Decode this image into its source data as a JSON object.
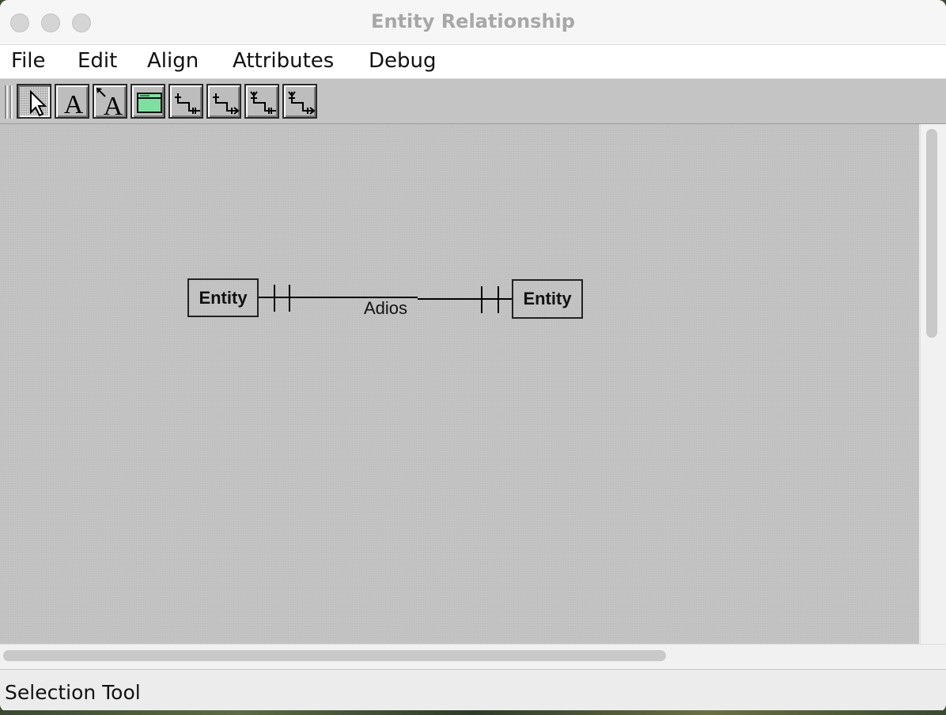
{
  "window": {
    "title": "Entity Relationship",
    "controls": [
      "close-button",
      "minimize-button",
      "zoom-button"
    ]
  },
  "menubar": {
    "items": [
      "File",
      "Edit",
      "Align",
      "Attributes",
      "Debug"
    ]
  },
  "toolbar": {
    "tools": [
      {
        "name": "selection-tool",
        "icon": "arrow-pointer-icon",
        "selected": true
      },
      {
        "name": "text-tool",
        "icon": "letter-a-icon",
        "selected": false
      },
      {
        "name": "connected-text-tool",
        "icon": "letter-a-with-arrow-icon",
        "selected": false
      },
      {
        "name": "entity-tool",
        "icon": "green-box-icon",
        "selected": false
      },
      {
        "name": "relationship-tool-1",
        "icon": "relation-one-one-icon",
        "selected": false
      },
      {
        "name": "relationship-tool-2",
        "icon": "relation-one-many-icon",
        "selected": false
      },
      {
        "name": "relationship-tool-3",
        "icon": "relation-many-one-icon",
        "selected": false
      },
      {
        "name": "relationship-tool-4",
        "icon": "relation-many-many-icon",
        "selected": false
      }
    ],
    "entity_icon_color": "#7ee0a0"
  },
  "diagram": {
    "entities": [
      {
        "label": "Entity"
      },
      {
        "label": "Entity"
      }
    ],
    "relationship": {
      "label": "Adios",
      "left_cardinality": "one-and-only-one",
      "right_cardinality": "one-and-only-one"
    }
  },
  "status": {
    "text": "Selection Tool"
  }
}
